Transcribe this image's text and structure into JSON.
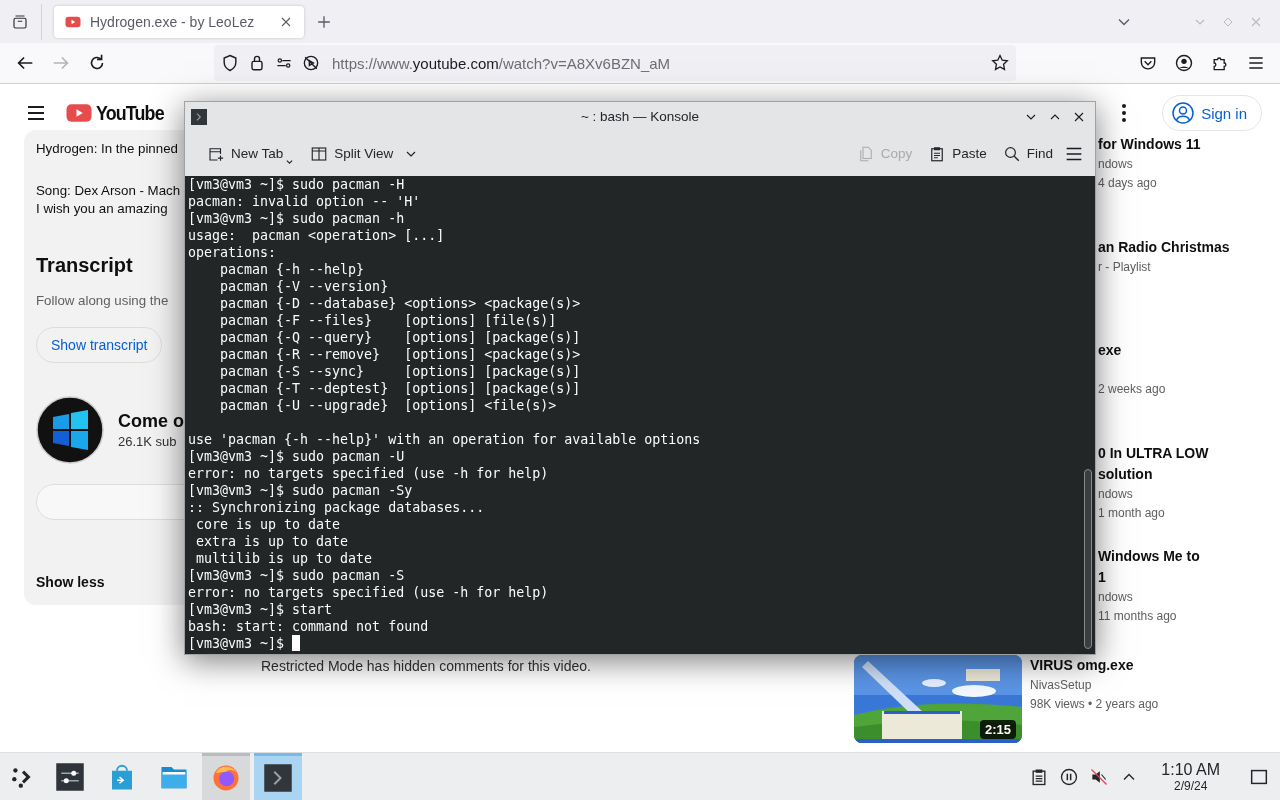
{
  "browser": {
    "tabs": [
      {
        "title": "Hydrogen.exe - by LeoLez",
        "selected": true
      }
    ],
    "nav_buttons": [
      {
        "kind": "back",
        "disabled": false
      },
      {
        "kind": "forward",
        "disabled": true
      },
      {
        "kind": "reload",
        "disabled": false
      }
    ],
    "url": {
      "scheme": "https://www.",
      "domain": "youtube.com",
      "path": "/watch?v=A8Xv6BZN_aM"
    }
  },
  "youtube": {
    "logo": "YouTube",
    "sign_in": "Sign in",
    "description": [
      [
        "Hydrogen: In the pinned"
      ],
      [
        "Song: Dex Arson - Mach",
        "I wish you an amazing"
      ]
    ],
    "transcript": {
      "heading": "Transcript",
      "text": "Follow along using the",
      "button": "Show transcript"
    },
    "channel": {
      "name": "Come o",
      "subscribers": "26.1K sub"
    },
    "show_less": "Show less",
    "restricted_notice": "Restricted Mode has hidden comments for this video.",
    "related": [
      {
        "title": [
          "for Windows 11"
        ],
        "channel": "ndows",
        "meta": "4 days ago"
      },
      {
        "title": [
          "an Radio Christmas"
        ],
        "channel": "r - Playlist"
      },
      {
        "title": [
          "exe"
        ],
        "meta": "2 weeks ago"
      },
      {
        "title": [
          "0 In ULTRA LOW",
          "solution"
        ],
        "channel": "ndows",
        "meta": "1 month ago"
      },
      {
        "title": [
          "Windows Me to",
          "1"
        ],
        "channel": "ndows",
        "meta": "11 months ago"
      },
      {
        "title": [
          "VIRUS omg.exe"
        ],
        "channel": "NivasSetup",
        "meta": "98K views • 2 years ago",
        "thumbnail": {
          "kind": "picture",
          "duration": "2:15"
        }
      }
    ]
  },
  "konsole": {
    "title": "~ : bash — Konsole",
    "toolbar_left": [
      {
        "kind": "new-tab",
        "label": "New Tab",
        "disabled": false
      },
      {
        "kind": "split-view",
        "label": "Split View",
        "disabled": false
      }
    ],
    "toolbar_right": [
      {
        "kind": "copy",
        "label": "Copy",
        "disabled": true
      },
      {
        "kind": "paste",
        "label": "Paste",
        "disabled": false
      },
      {
        "kind": "find",
        "label": "Find",
        "disabled": false
      }
    ],
    "blocks": [
      {
        "lines": [
          "[vm3@vm3 ~]$ sudo pacman -H",
          "pacman: invalid option -- 'H'",
          "[vm3@vm3 ~]$ sudo pacman -h",
          "usage:  pacman <operation> [...]",
          "operations:",
          "    pacman {-h --help}",
          "    pacman {-V --version}",
          "    pacman {-D --database} <options> <package(s)>",
          "    pacman {-F --files}    [options] [file(s)]",
          "    pacman {-Q --query}    [options] [package(s)]",
          "    pacman {-R --remove}   [options] <package(s)>",
          "    pacman {-S --sync}     [options] [package(s)]",
          "    pacman {-T --deptest}  [options] [package(s)]",
          "    pacman {-U --upgrade}  [options] <file(s)>"
        ]
      },
      {
        "lines": [
          "use 'pacman {-h --help}' with an operation for available options",
          "[vm3@vm3 ~]$ sudo pacman -U",
          "error: no targets specified (use -h for help)",
          "[vm3@vm3 ~]$ sudo pacman -Sy",
          ":: Synchronizing package databases...",
          " core is up to date",
          " extra is up to date",
          " multilib is up to date",
          "[vm3@vm3 ~]$ sudo pacman -S",
          "error: no targets specified (use -h for help)",
          "[vm3@vm3 ~]$ start",
          "bash: start: command not found",
          "[vm3@vm3 ~]$ "
        ]
      }
    ],
    "cursor": true
  },
  "taskbar": {
    "apps": [
      {
        "kind": "settings",
        "running": false,
        "selected": false
      },
      {
        "kind": "discover",
        "running": false,
        "selected": false
      },
      {
        "kind": "files",
        "running": false,
        "selected": false
      },
      {
        "kind": "firefox",
        "running": true,
        "selected": false
      },
      {
        "kind": "konsole",
        "running": true,
        "selected": true
      }
    ],
    "tray": [
      {
        "kind": "clipboard"
      },
      {
        "kind": "pause"
      },
      {
        "kind": "muted"
      },
      {
        "kind": "chevron-up"
      }
    ],
    "time": "1:10 AM",
    "date": "2/9/24"
  }
}
